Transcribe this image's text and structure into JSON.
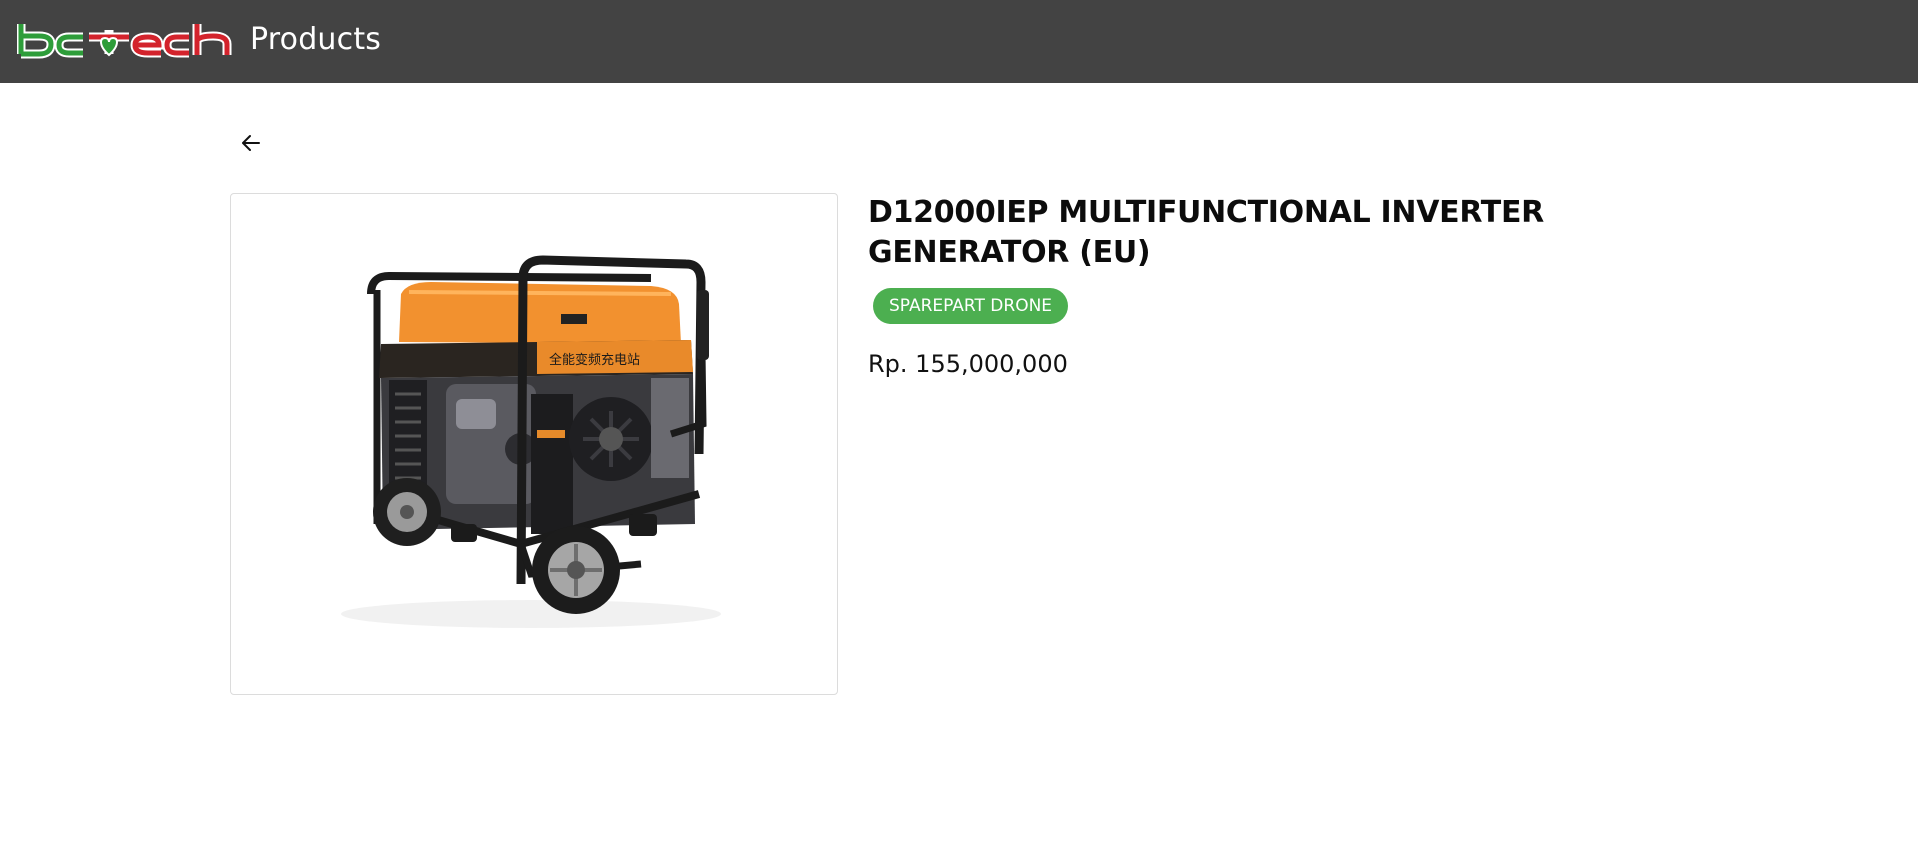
{
  "header": {
    "logo_text": "bctech",
    "title": "Products",
    "background_color": "#434343"
  },
  "navigation": {
    "back_icon": "arrow-left-icon"
  },
  "product": {
    "name": "D12000IEP MULTIFUNCTIONAL INVERTER GENERATOR (EU)",
    "category": "SPAREPART DRONE",
    "price": "Rp. 155,000,000",
    "image_label": "全能变频充电站",
    "badge_color": "#4caf50"
  }
}
